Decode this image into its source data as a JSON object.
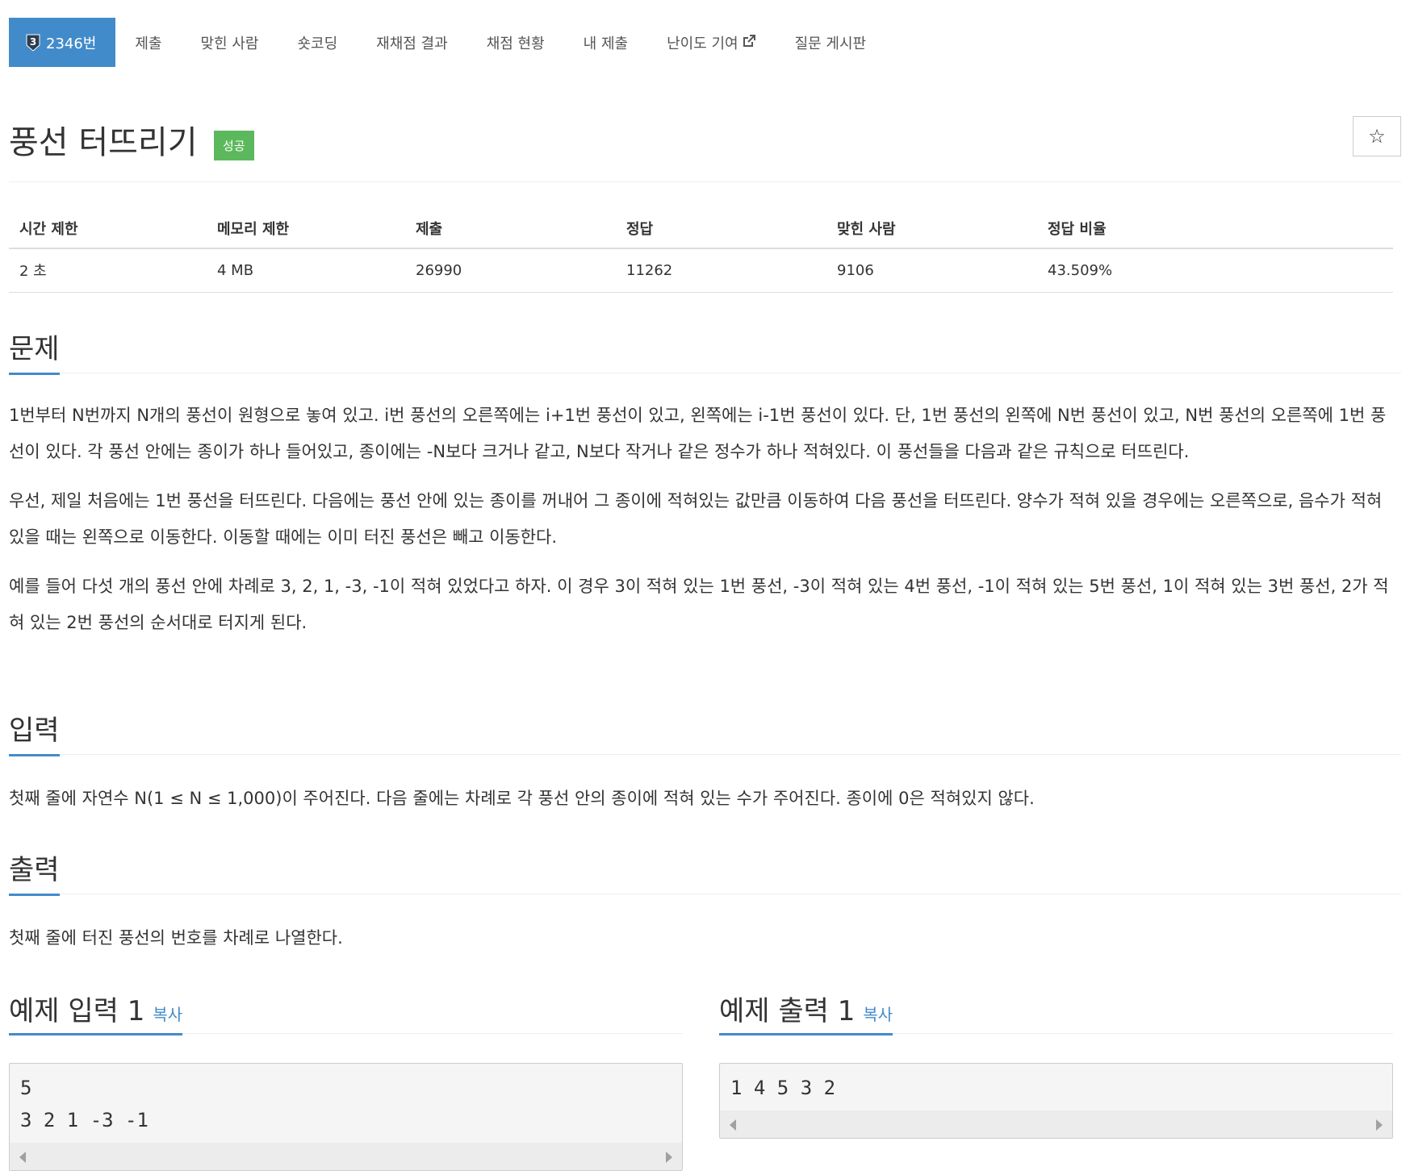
{
  "nav": {
    "tier": "3",
    "items": [
      {
        "label": "2346번"
      },
      {
        "label": "제출"
      },
      {
        "label": "맞힌 사람"
      },
      {
        "label": "숏코딩"
      },
      {
        "label": "재채점 결과"
      },
      {
        "label": "채점 현황"
      },
      {
        "label": "내 제출"
      },
      {
        "label": "난이도 기여"
      },
      {
        "label": "질문 게시판"
      }
    ]
  },
  "problem": {
    "title": "풍선 터뜨리기",
    "result_badge": "성공",
    "star_icon": "☆"
  },
  "info_table": {
    "headers": [
      "시간 제한",
      "메모리 제한",
      "제출",
      "정답",
      "맞힌 사람",
      "정답 비율"
    ],
    "values": [
      "2 초",
      "4 MB",
      "26990",
      "11262",
      "9106",
      "43.509%"
    ]
  },
  "sections": {
    "description": {
      "heading": "문제",
      "paragraphs": [
        "1번부터 N번까지 N개의 풍선이 원형으로 놓여 있고. i번 풍선의 오른쪽에는 i+1번 풍선이 있고, 왼쪽에는 i-1번 풍선이 있다. 단, 1번 풍선의 왼쪽에 N번 풍선이 있고, N번 풍선의 오른쪽에 1번 풍선이 있다. 각 풍선 안에는 종이가 하나 들어있고, 종이에는 -N보다 크거나 같고, N보다 작거나 같은 정수가 하나 적혀있다. 이 풍선들을 다음과 같은 규칙으로 터뜨린다.",
        "우선, 제일 처음에는 1번 풍선을 터뜨린다. 다음에는 풍선 안에 있는 종이를 꺼내어 그 종이에 적혀있는 값만큼 이동하여 다음 풍선을 터뜨린다. 양수가 적혀 있을 경우에는 오른쪽으로, 음수가 적혀 있을 때는 왼쪽으로 이동한다. 이동할 때에는 이미 터진 풍선은 빼고 이동한다.",
        "예를 들어 다섯 개의 풍선 안에 차례로 3, 2, 1, -3, -1이 적혀 있었다고 하자. 이 경우 3이 적혀 있는 1번 풍선, -3이 적혀 있는 4번 풍선, -1이 적혀 있는 5번 풍선, 1이 적혀 있는 3번 풍선, 2가 적혀 있는 2번 풍선의 순서대로 터지게 된다."
      ]
    },
    "input": {
      "heading": "입력",
      "text": "첫째 줄에 자연수 N(1 ≤ N ≤ 1,000)이 주어진다. 다음 줄에는 차례로 각 풍선 안의 종이에 적혀 있는 수가 주어진다. 종이에 0은 적혀있지 않다."
    },
    "output": {
      "heading": "출력",
      "text": "첫째 줄에 터진 풍선의 번호를 차례로 나열한다."
    }
  },
  "samples": {
    "input": {
      "heading": "예제 입력 1",
      "copy_label": "복사",
      "content": "5\n3 2 1 -3 -1"
    },
    "output": {
      "heading": "예제 출력 1",
      "copy_label": "복사",
      "content": "1 4 5 3 2"
    }
  },
  "colors": {
    "accent": "#428bca",
    "success": "#5cb85c"
  }
}
